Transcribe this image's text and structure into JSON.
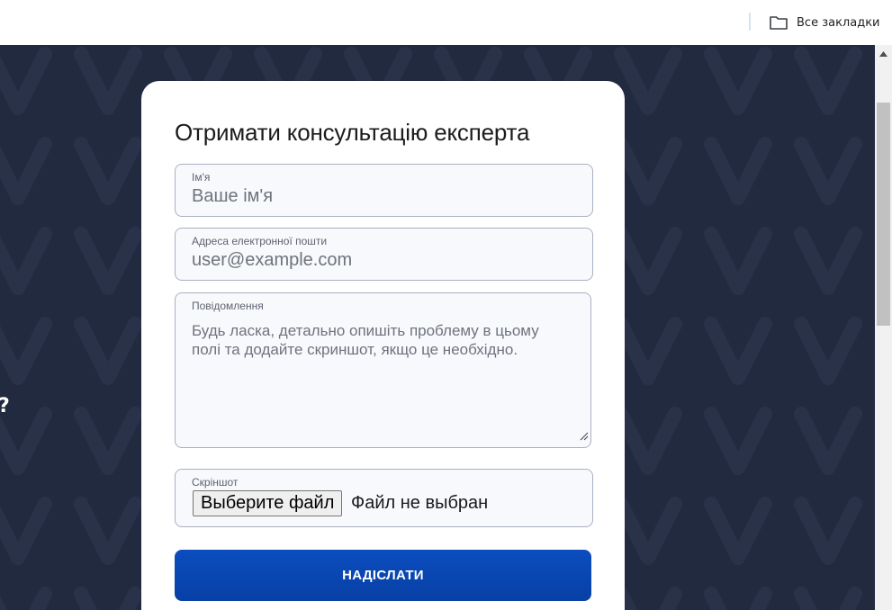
{
  "browser": {
    "bookmarks_all_label": "Все закладки",
    "folder_icon": "folder-icon"
  },
  "page": {
    "side_text": "?"
  },
  "form": {
    "title": "Отримати консультацію експерта",
    "name": {
      "label": "Ім'я",
      "placeholder": "Ваше ім'я"
    },
    "email": {
      "label": "Адреса електронної пошти",
      "placeholder": "user@example.com"
    },
    "message": {
      "label": "Повідомлення",
      "placeholder": "Будь ласка, детально опишіть проблему в цьому полі та додайте скриншот, якщо це необхідно."
    },
    "screenshot": {
      "label": "Скріншот",
      "button_label": "Выберите файл",
      "status": "Файл не выбран"
    },
    "submit_label": "НАДІСЛАТИ"
  },
  "colors": {
    "page_background": "#222a40",
    "submit_button": "#0b4dbf",
    "field_background": "#f8f9fd"
  }
}
